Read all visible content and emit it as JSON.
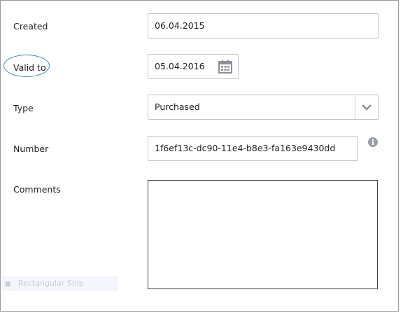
{
  "form": {
    "created": {
      "label": "Created",
      "value": "06.04.2015"
    },
    "valid_to": {
      "label": "Valid to",
      "value": "05.04.2016",
      "icon": "calendar-icon"
    },
    "type": {
      "label": "Type",
      "value": "Purchased",
      "icon": "chevron-down-icon"
    },
    "number": {
      "label": "Number",
      "value": "1f6ef13c-dc90-11e4-b8e3-fa163e9430dd",
      "icon": "info-icon"
    },
    "comments": {
      "label": "Comments",
      "value": ""
    }
  },
  "overlay": {
    "snip_label": "Rectangular Snip",
    "annotation_color": "#3a8fb8"
  },
  "colors": {
    "field_border": "#c4c4c4",
    "icon_gray": "#8a9199",
    "text": "#222222"
  }
}
